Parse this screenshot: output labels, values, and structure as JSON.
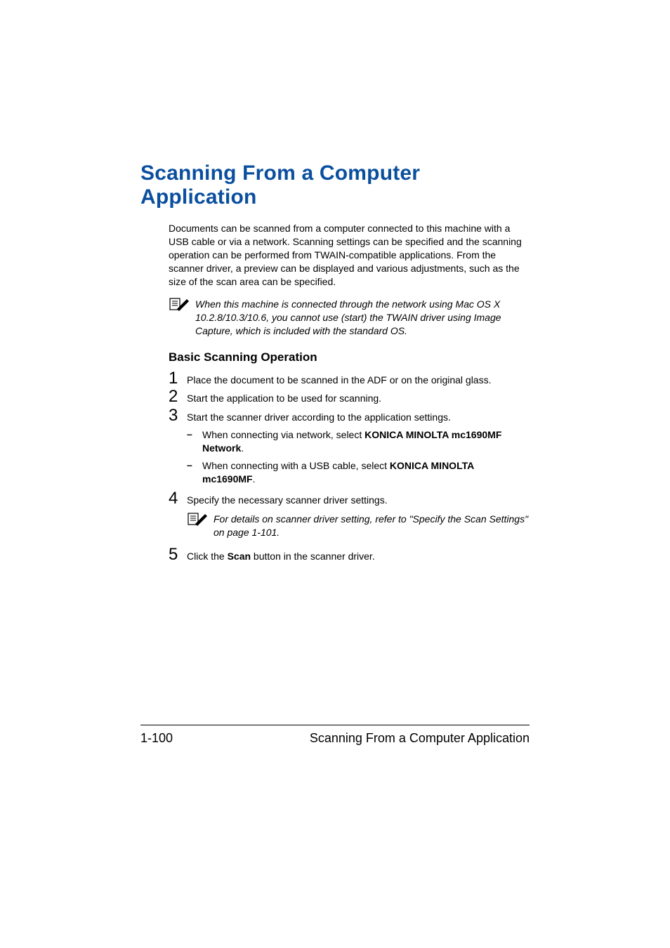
{
  "title": "Scanning From a Computer Application",
  "intro": "Documents can be scanned from a computer connected to this machine with a USB cable or via a network. Scanning settings can be specified and the scanning operation can be performed from TWAIN-compatible applications. From the scanner driver, a preview can be displayed and various adjustments, such as the size of the scan area can be specified.",
  "note1": "When this machine is connected through the network using Mac OS X 10.2.8/10.3/10.6, you cannot use (start) the TWAIN driver using Image Capture, which is included with the standard OS.",
  "subhead": "Basic Scanning Operation",
  "steps": {
    "s1": {
      "num": "1",
      "text": "Place the document to be scanned in the ADF or on the original glass."
    },
    "s2": {
      "num": "2",
      "text": "Start the application to be used for scanning."
    },
    "s3": {
      "num": "3",
      "text": "Start the scanner driver according to the application settings.",
      "b1_pre": "When connecting via network, select ",
      "b1_bold": "KONICA MINOLTA mc1690MF Network",
      "b1_post": ".",
      "b2_pre": "When connecting with a USB cable, select ",
      "b2_bold": "KONICA MINOLTA mc1690MF",
      "b2_post": "."
    },
    "s4": {
      "num": "4",
      "text": "Specify the necessary scanner driver settings.",
      "note": "For details on scanner driver setting, refer to \"Specify the Scan Settings\" on page 1-101."
    },
    "s5": {
      "num": "5",
      "pre": "Click the ",
      "bold": "Scan",
      "post": " button in the scanner driver."
    }
  },
  "footer": {
    "page": "1-100",
    "title": "Scanning From a Computer Application"
  },
  "dash": "–"
}
